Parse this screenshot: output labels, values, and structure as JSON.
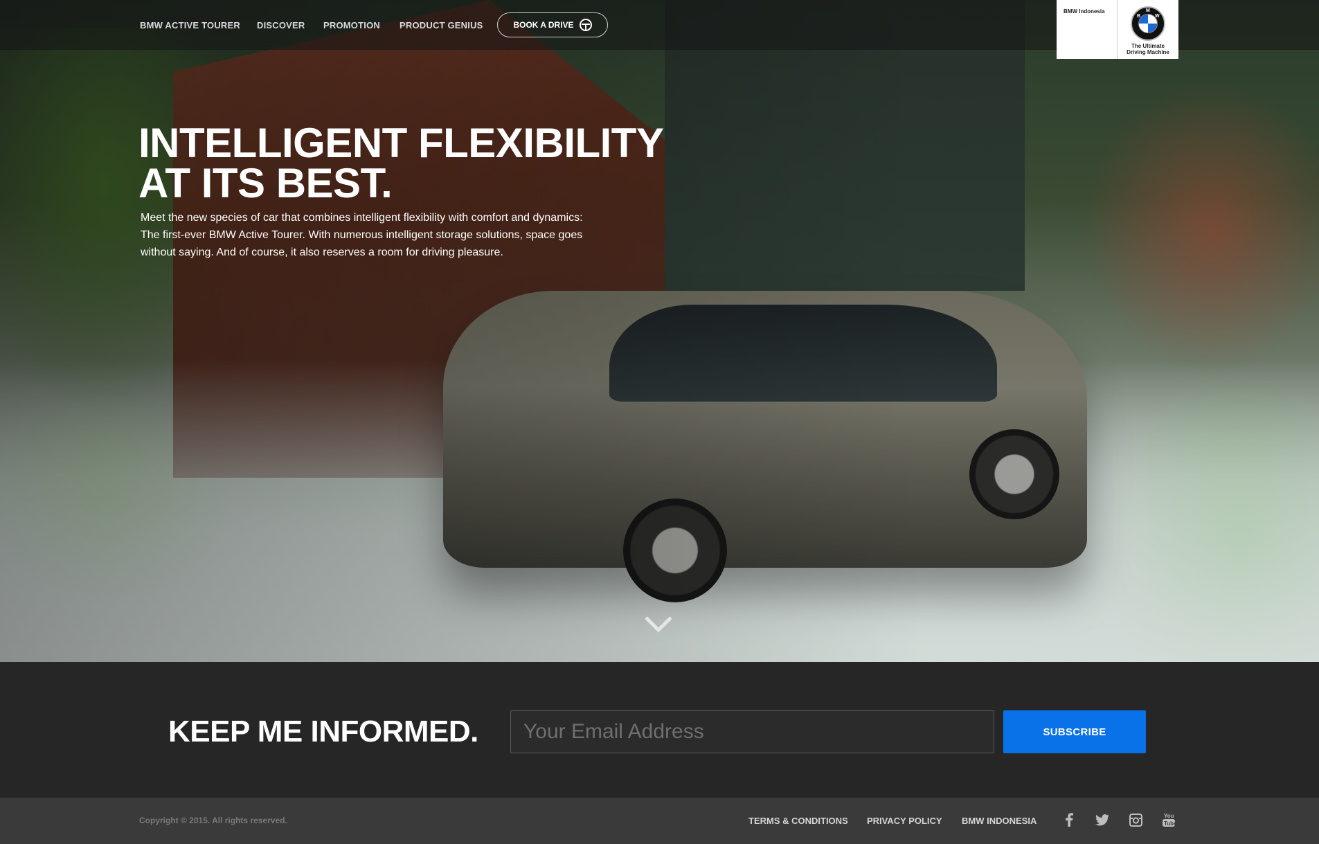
{
  "nav": {
    "items": [
      "BMW ACTIVE TOURER",
      "DISCOVER",
      "PROMOTION",
      "PRODUCT GENIUS"
    ],
    "book_label": "BOOK A DRIVE"
  },
  "logo": {
    "brand_text": "BMW Indonesia",
    "roundel_letters": [
      "B",
      "M",
      "W"
    ],
    "tagline_line1": "The Ultimate",
    "tagline_line2": "Driving Machine"
  },
  "hero": {
    "headline_line1": "INTELLIGENT FLEXIBILITY",
    "headline_line2": "AT ITS BEST.",
    "intro": "Meet the new species of car that combines intelligent flexibility with comfort and dynamics: The first-ever BMW Active Tourer. With numerous intelligent storage solutions, space goes without saying. And of course, it also reserves a room for driving pleasure."
  },
  "newsletter": {
    "title": "KEEP ME INFORMED.",
    "email_placeholder": "Your Email Address",
    "email_value": "",
    "subscribe_label": "SUBSCRIBE"
  },
  "footer": {
    "copyright": "Copyright © 2015. All rights reserved.",
    "links": [
      "TERMS & CONDITIONS",
      "PRIVACY POLICY",
      "BMW INDONESIA"
    ],
    "social": [
      "facebook-icon",
      "twitter-icon",
      "instagram-icon",
      "youtube-icon"
    ]
  },
  "colors": {
    "accent_blue": "#0a72e8",
    "newsletter_bg": "#262626",
    "footer_bg": "#3a3a3a"
  }
}
